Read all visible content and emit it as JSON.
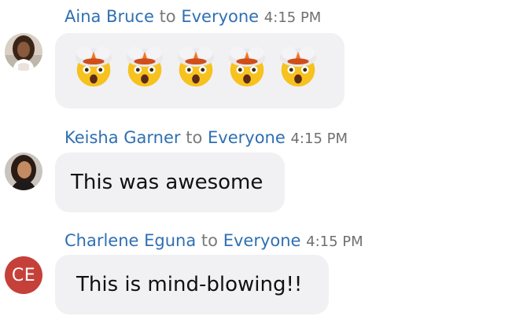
{
  "messages": [
    {
      "sender": "Aina Bruce",
      "connector": "to",
      "target": "Everyone",
      "time": "4:15 PM",
      "avatar": {
        "type": "photo",
        "description_icon": "user-photo-avatar"
      },
      "content_type": "emoji",
      "emoji": [
        "🤯",
        "🤯",
        "🤯",
        "🤯",
        "🤯"
      ]
    },
    {
      "sender": "Keisha Garner",
      "connector": "to",
      "target": "Everyone",
      "time": "4:15 PM",
      "avatar": {
        "type": "photo",
        "description_icon": "user-photo-avatar"
      },
      "content_type": "text",
      "text": "This was awesome"
    },
    {
      "sender": "Charlene Eguna",
      "connector": "to",
      "target": "Everyone",
      "time": "4:15 PM",
      "avatar": {
        "type": "initials",
        "initials": "CE",
        "color": "#c6403a"
      },
      "content_type": "text",
      "text": "This is mind-blowing!!"
    }
  ],
  "colors": {
    "link_blue": "#2f6fb2",
    "bubble_bg": "#f1f1f4",
    "meta_gray": "#707070"
  }
}
